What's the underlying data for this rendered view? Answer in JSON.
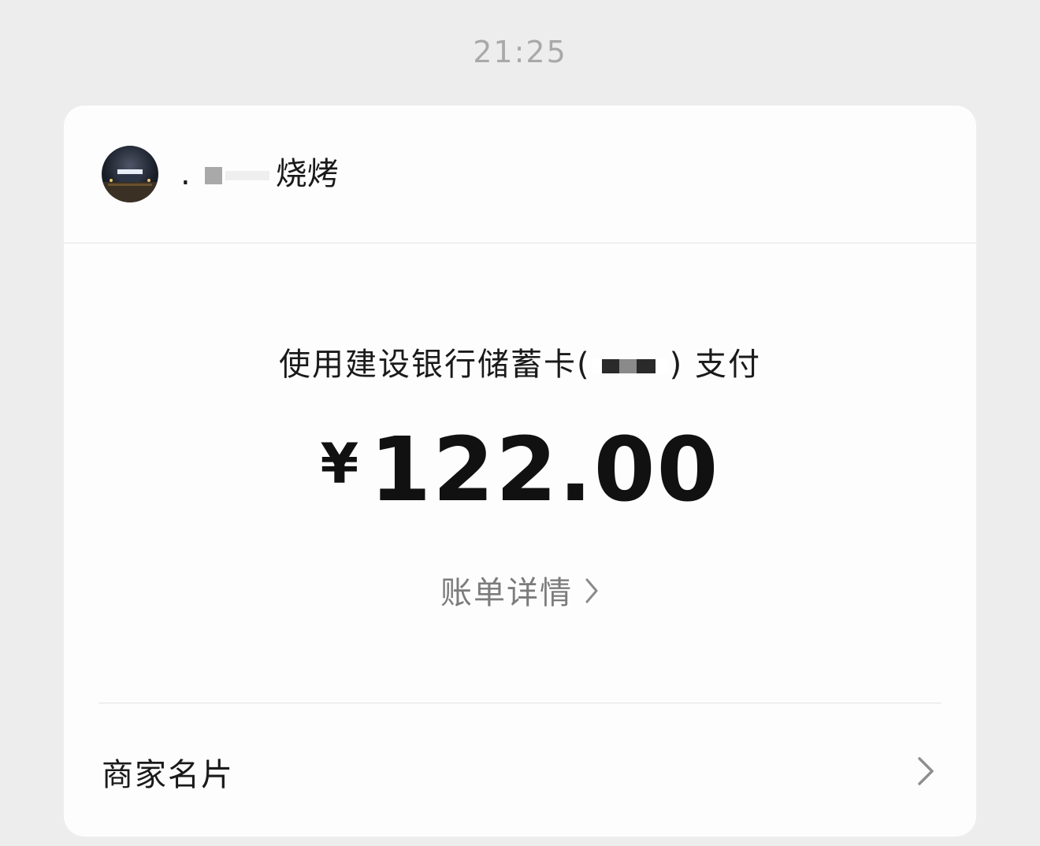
{
  "timestamp": "21:25",
  "merchant": {
    "name_visible": "烧烤",
    "name_prefix_partial": "."
  },
  "payment": {
    "method_prefix": "使用建设银行储蓄卡",
    "method_open_paren": "(",
    "method_close_paren": ")",
    "method_suffix": "支付",
    "currency_symbol": "¥",
    "amount": "122.00"
  },
  "bill_detail": {
    "label": "账单详情"
  },
  "merchant_card": {
    "label": "商家名片"
  },
  "icons": {
    "bill_detail_chevron": "chevron-right-icon",
    "merchant_card_chevron": "chevron-right-icon",
    "merchant_avatar": "avatar"
  },
  "colors": {
    "background": "#ededed",
    "card": "#fdfdfd",
    "primary_text": "#1a1a1a",
    "secondary_text": "#7c7c7c",
    "timestamp_text": "#a9a9a9"
  }
}
